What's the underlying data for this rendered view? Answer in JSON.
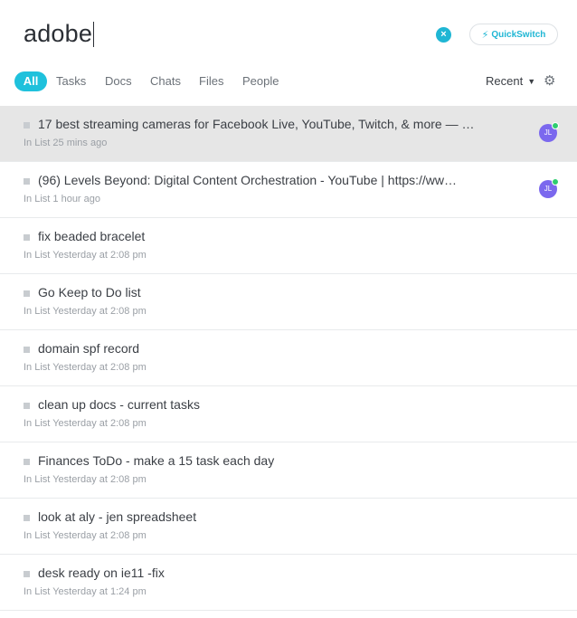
{
  "search": {
    "query": "adobe"
  },
  "quickswitch": {
    "prefix": "Quick",
    "suffix": "Switch",
    "icon": "bolt-icon"
  },
  "clear_icon": "×",
  "tabs": [
    {
      "label": "All",
      "active": true
    },
    {
      "label": "Tasks",
      "active": false
    },
    {
      "label": "Docs",
      "active": false
    },
    {
      "label": "Chats",
      "active": false
    },
    {
      "label": "Files",
      "active": false
    },
    {
      "label": "People",
      "active": false
    }
  ],
  "sort": {
    "label": "Recent",
    "chevron": "▼",
    "settings_icon": "⚙"
  },
  "colors": {
    "accent": "#1fc1dc",
    "avatar": "#7b68ee",
    "online": "#2ecd6f",
    "selected_row": "#e6e6e6"
  },
  "results": [
    {
      "title": "17 best streaming cameras for Facebook Live, YouTube, Twitch, & more — …",
      "meta": "In List 25 mins ago",
      "avatar": "JL",
      "selected": true
    },
    {
      "title": "(96) Levels Beyond: Digital Content Orchestration - YouTube | https://ww…",
      "meta": "In List 1 hour ago",
      "avatar": "JL",
      "selected": false
    },
    {
      "title": "fix beaded bracelet",
      "meta": "In List Yesterday at 2:08 pm"
    },
    {
      "title": "Go Keep to Do list",
      "meta": "In List Yesterday at 2:08 pm"
    },
    {
      "title": "domain spf record",
      "meta": "In List Yesterday at 2:08 pm"
    },
    {
      "title": "clean up docs - current tasks",
      "meta": "In List Yesterday at 2:08 pm"
    },
    {
      "title": "Finances ToDo - make a 15 task each day",
      "meta": "In List Yesterday at 2:08 pm"
    },
    {
      "title": "look at aly - jen spreadsheet",
      "meta": "In List Yesterday at 2:08 pm"
    },
    {
      "title": "desk ready on ie11 -fix",
      "meta": "In List Yesterday at 1:24 pm"
    }
  ]
}
